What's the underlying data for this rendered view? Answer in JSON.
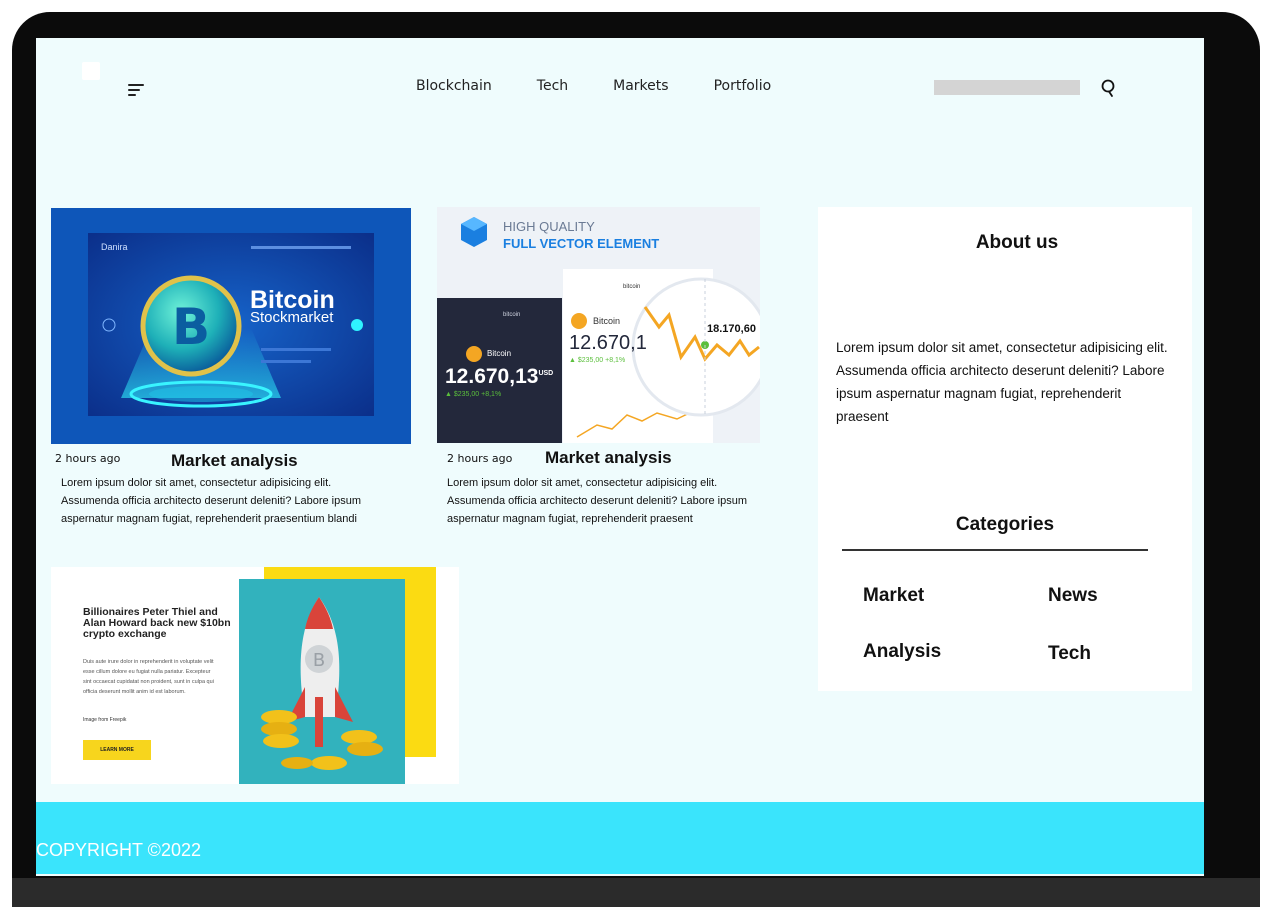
{
  "nav": {
    "items": [
      "Blockchain",
      "Tech",
      "Markets",
      "Portfolio"
    ]
  },
  "search": {
    "placeholder": ""
  },
  "cards": [
    {
      "banner_brand": "Danira",
      "banner_title": "Bitcoin",
      "banner_subtitle": "Stockmarket",
      "time": "2 hours ago",
      "title": "Market analysis",
      "text": "Lorem ipsum dolor sit amet, consectetur adipisicing elit. Assumenda officia architecto deserunt deleniti? Labore ipsum aspernatur magnam fugiat, reprehenderit praesentium blandi"
    },
    {
      "banner_line1": "HIGH QUALITY",
      "banner_line2": "FULL VECTOR ELEMENT",
      "app_name": "bitcoin",
      "coin_label": "Bitcoin",
      "price_dark": "12.670,13",
      "price_unit": "USD",
      "change_dark": "▲ $235,00  +8,1%",
      "price_light": "12.670,1",
      "change_light": "▲ $235,00  +8,1%",
      "zoom_value": "18.170,60",
      "time": "2 hours ago",
      "title": "Market analysis",
      "text": "Lorem ipsum dolor sit amet, consectetur adipisicing elit. Assumenda officia architecto deserunt deleniti? Labore ipsum aspernatur magnam fugiat, reprehenderit praesent"
    }
  ],
  "promo": {
    "headline": "Billionaires Peter Thiel and Alan Howard back new $10bn crypto exchange",
    "body": "Duis aute irure dolor in reprehenderit in voluptate velit esse cillum dolore eu fugiat nulla pariatur. Excepteur sint occaecat cupidatat non proident, sunt in culpa qui officia deserunt mollit anim id est laborum.",
    "credit": "Image from Freepik",
    "button": "LEARN MORE"
  },
  "sidebar": {
    "about_title": "About us",
    "about_text": "Lorem ipsum dolor sit amet, consectetur adipisicing elit. Assumenda officia architecto deserunt deleniti? Labore ipsum aspernatur magnam fugiat, reprehenderit praesent",
    "categories_title": "Categories",
    "categories": [
      "Market",
      "News",
      "Analysis",
      "Tech"
    ]
  },
  "footer": {
    "copyright": "COPYRIGHT ©2022"
  },
  "colors": {
    "screen_bg": "#effcfd",
    "footer_bg": "#3ae4fc",
    "bezel": "#0b0b0b"
  }
}
